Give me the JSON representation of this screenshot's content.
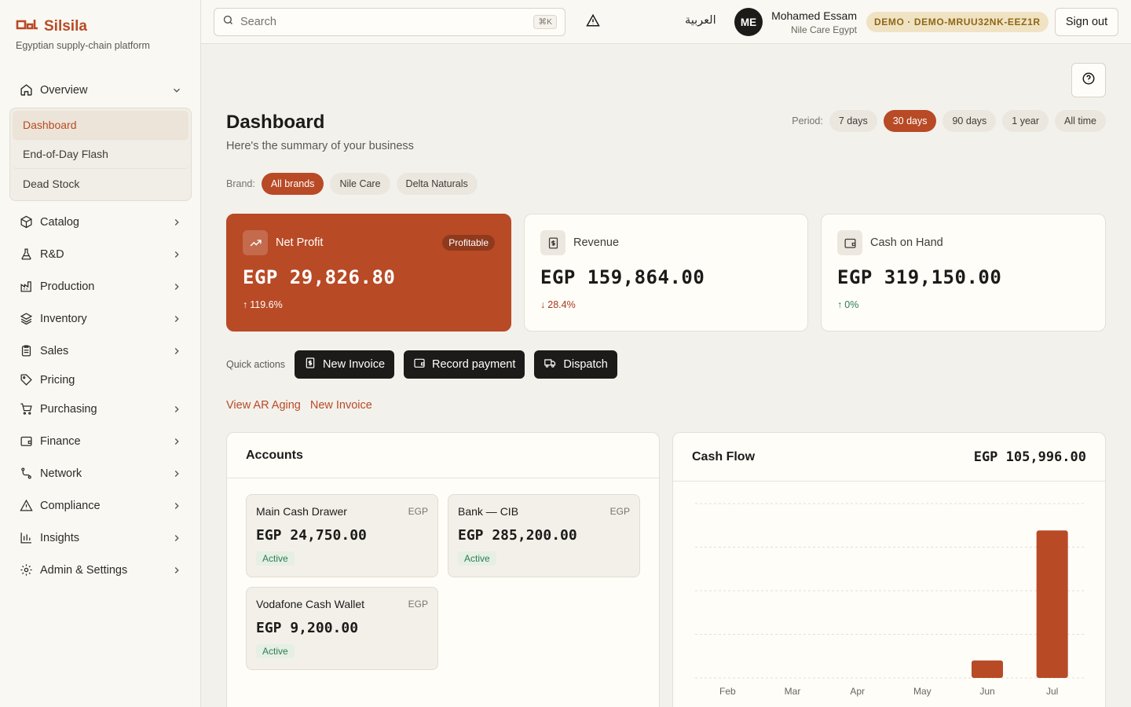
{
  "brand": {
    "name": "Silsila",
    "subtitle": "Egyptian supply-chain platform"
  },
  "sidebar": {
    "overview": {
      "label": "Overview",
      "icon": "home-icon"
    },
    "subitems": [
      {
        "label": "Dashboard",
        "active": true
      },
      {
        "label": "End-of-Day Flash"
      },
      {
        "label": "Dead Stock"
      }
    ],
    "items": [
      {
        "label": "Catalog",
        "icon": "box-icon"
      },
      {
        "label": "R&D",
        "icon": "flask-icon"
      },
      {
        "label": "Production",
        "icon": "factory-icon"
      },
      {
        "label": "Inventory",
        "icon": "layers-icon"
      },
      {
        "label": "Sales",
        "icon": "clipboard-icon"
      },
      {
        "label": "Pricing",
        "icon": "tag-icon"
      },
      {
        "label": "Purchasing",
        "icon": "cart-icon"
      },
      {
        "label": "Finance",
        "icon": "wallet-icon"
      },
      {
        "label": "Network",
        "icon": "route-icon"
      },
      {
        "label": "Compliance",
        "icon": "warning-icon"
      },
      {
        "label": "Insights",
        "icon": "bar-chart-icon"
      },
      {
        "label": "Admin & Settings",
        "icon": "gear-icon"
      }
    ]
  },
  "topbar": {
    "search_placeholder": "Search",
    "search_shortcut": "⌘K",
    "language": "العربية",
    "avatar_initials": "ME",
    "user_name": "Mohamed Essam",
    "user_org": "Nile Care Egypt",
    "demo_badge": "DEMO · DEMO-MRUU32NK-EEZ1R",
    "sign_out": "Sign out"
  },
  "page": {
    "title": "Dashboard",
    "subtitle": "Here's the summary of your business",
    "period_label": "Period:",
    "periods": [
      {
        "label": "7 days"
      },
      {
        "label": "30 days",
        "active": true
      },
      {
        "label": "90 days"
      },
      {
        "label": "1 year"
      },
      {
        "label": "All time"
      }
    ],
    "brand_label": "Brand:",
    "brands": [
      {
        "label": "All brands",
        "active": true
      },
      {
        "label": "Nile Care"
      },
      {
        "label": "Delta Naturals"
      }
    ]
  },
  "kpis": {
    "net_profit": {
      "label": "Net Profit",
      "badge": "Profitable",
      "value": "EGP 29,826.80",
      "change": "119.6%"
    },
    "revenue": {
      "label": "Revenue",
      "value": "EGP 159,864.00",
      "change": "28.4%"
    },
    "cash": {
      "label": "Cash on Hand",
      "value": "EGP 319,150.00",
      "change": "0%"
    }
  },
  "quick_actions": {
    "label": "Quick actions",
    "new_invoice": "New Invoice",
    "record_payment": "Record payment",
    "dispatch": "Dispatch"
  },
  "links": {
    "ar_aging": "View AR Aging",
    "new_invoice": "New Invoice"
  },
  "accounts": {
    "title": "Accounts",
    "list": [
      {
        "name": "Main Cash Drawer",
        "currency": "EGP",
        "value": "EGP 24,750.00",
        "status": "Active"
      },
      {
        "name": "Bank — CIB",
        "currency": "EGP",
        "value": "EGP 285,200.00",
        "status": "Active"
      },
      {
        "name": "Vodafone Cash Wallet",
        "currency": "EGP",
        "value": "EGP 9,200.00",
        "status": "Active"
      }
    ]
  },
  "cashflow": {
    "title": "Cash Flow",
    "total": "EGP 105,996.00"
  },
  "colors": {
    "accent": "#b84a26",
    "success": "#2c7d52",
    "demo": "#8f6615"
  },
  "chart_data": {
    "type": "bar",
    "categories": [
      "Feb",
      "Mar",
      "Apr",
      "May",
      "Jun",
      "Jul"
    ],
    "values": [
      0,
      0,
      0,
      0,
      11000,
      93000
    ],
    "ylim": [
      0,
      110000
    ],
    "grid": true,
    "color": "#b84a26"
  }
}
